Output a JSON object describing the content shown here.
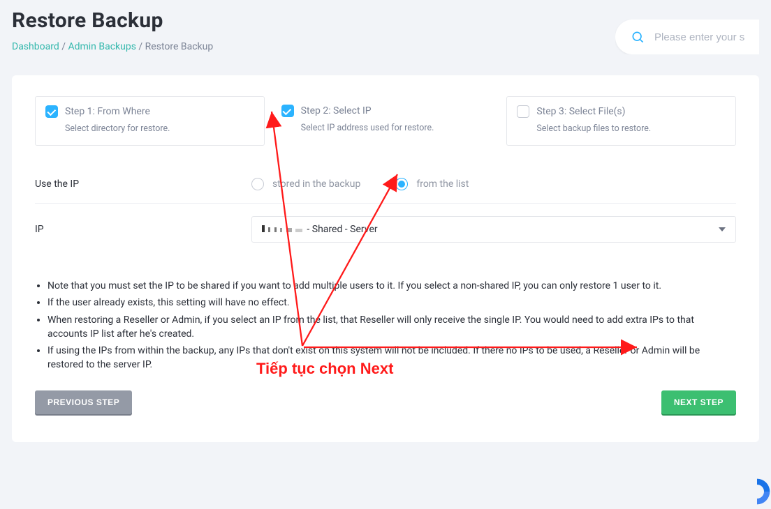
{
  "page": {
    "title": "Restore Backup",
    "breadcrumb": {
      "dashboard": "Dashboard",
      "admin_backups": "Admin Backups",
      "current": "Restore Backup"
    }
  },
  "search": {
    "placeholder": "Please enter your s"
  },
  "steps": {
    "s1": {
      "title": "Step 1: From Where",
      "desc": "Select directory for restore."
    },
    "s2": {
      "title": "Step 2: Select IP",
      "desc": "Select IP address used for restore."
    },
    "s3": {
      "title": "Step 3: Select File(s)",
      "desc": "Select backup files to restore."
    }
  },
  "form": {
    "use_ip_label": "Use the IP",
    "opt_stored": "stored in the backup",
    "opt_list": "from the list",
    "ip_label": "IP",
    "ip_select_visible": " - Shared - Server"
  },
  "notes": {
    "n1": "Note that you must set the IP to be shared if you want to add multiple users to it. If you select a non-shared IP, you can only restore 1 user to it.",
    "n2": "If the user already exists, this setting will have no effect.",
    "n3": "When restoring a Reseller or Admin, if you select an IP from the list, that Reseller will only receive the single IP. You would need to add extra IPs to that accounts IP list after he's created.",
    "n4": "If using the IPs from within the backup, any IPs that don't exist on this system will not be included. If there no IPs to be used, a Reseller or Admin will be restored to the server IP."
  },
  "buttons": {
    "prev": "Previous Step",
    "next": "Next Step"
  },
  "annotation": "Tiếp tục chọn Next",
  "colors": {
    "accent_cyan": "#2bb3ff",
    "accent_teal": "#34b8ad",
    "btn_green": "#3cbf71",
    "btn_gray": "#949aa6",
    "ann_red": "#ff1a1a"
  }
}
